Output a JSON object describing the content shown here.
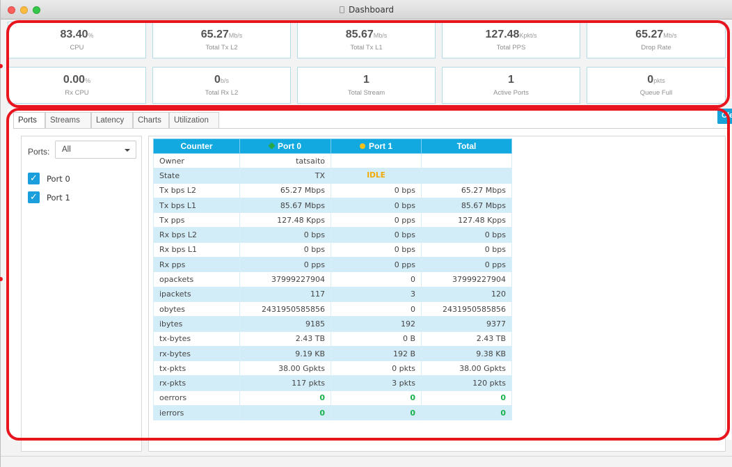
{
  "window": {
    "title": "Dashboard"
  },
  "stats": [
    {
      "value": "83.40",
      "unit": "%",
      "label": "CPU"
    },
    {
      "value": "65.27",
      "unit": "Mb/s",
      "label": "Total Tx L2"
    },
    {
      "value": "85.67",
      "unit": "Mb/s",
      "label": "Total Tx L1"
    },
    {
      "value": "127.48",
      "unit": "Kpkt/s",
      "label": "Total PPS"
    },
    {
      "value": "65.27",
      "unit": "Mb/s",
      "label": "Drop Rate"
    },
    {
      "value": "0.00",
      "unit": "%",
      "label": "Rx CPU"
    },
    {
      "value": "0",
      "unit": "b/s",
      "label": "Total Rx L2"
    },
    {
      "value": "1",
      "unit": "",
      "label": "Total Stream"
    },
    {
      "value": "1",
      "unit": "",
      "label": "Active Ports"
    },
    {
      "value": "0",
      "unit": "pkts",
      "label": "Queue Full"
    }
  ],
  "tabs": [
    "Ports",
    "Streams",
    "Latency",
    "Charts",
    "Utilization"
  ],
  "clear_button": "Clear",
  "ports_filter": {
    "label": "Ports:",
    "selected": "All"
  },
  "ports": [
    {
      "label": "Port 0",
      "checked": true
    },
    {
      "label": "Port 1",
      "checked": true
    }
  ],
  "table": {
    "headers": [
      "Counter",
      "Port 0",
      "Port 1",
      "Total"
    ],
    "rows": [
      [
        "Owner",
        "tatsaito",
        "",
        ""
      ],
      [
        "State",
        "TX",
        "IDLE",
        ""
      ],
      [
        "Tx bps L2",
        "65.27 Mbps",
        "0 bps",
        "65.27 Mbps"
      ],
      [
        "Tx bps L1",
        "85.67 Mbps",
        "0 bps",
        "85.67 Mbps"
      ],
      [
        "Tx pps",
        "127.48 Kpps",
        "0 pps",
        "127.48 Kpps"
      ],
      [
        "Rx bps L2",
        "0 bps",
        "0 bps",
        "0 bps"
      ],
      [
        "Rx bps L1",
        "0 bps",
        "0 bps",
        "0 bps"
      ],
      [
        "Rx pps",
        "0 pps",
        "0 pps",
        "0 pps"
      ],
      [
        "opackets",
        "37999227904",
        "0",
        "37999227904"
      ],
      [
        "ipackets",
        "117",
        "3",
        "120"
      ],
      [
        "obytes",
        "2431950585856",
        "0",
        "2431950585856"
      ],
      [
        "ibytes",
        "9185",
        "192",
        "9377"
      ],
      [
        "tx-bytes",
        "2.43 TB",
        "0 B",
        "2.43 TB"
      ],
      [
        "rx-bytes",
        "9.19 KB",
        "192 B",
        "9.38 KB"
      ],
      [
        "tx-pkts",
        "38.00 Gpkts",
        "0 pkts",
        "38.00 Gpkts"
      ],
      [
        "rx-pkts",
        "117 pkts",
        "3 pkts",
        "120 pkts"
      ],
      [
        "oerrors",
        "0",
        "0",
        "0"
      ],
      [
        "ierrors",
        "0",
        "0",
        "0"
      ]
    ]
  },
  "colors": {
    "accent": "#12a9e0",
    "idle": "#f2a900",
    "ok_green": "#19b24b",
    "port0": "#2aa845",
    "port1": "#f6c21a",
    "highlight": "#e8141e"
  }
}
